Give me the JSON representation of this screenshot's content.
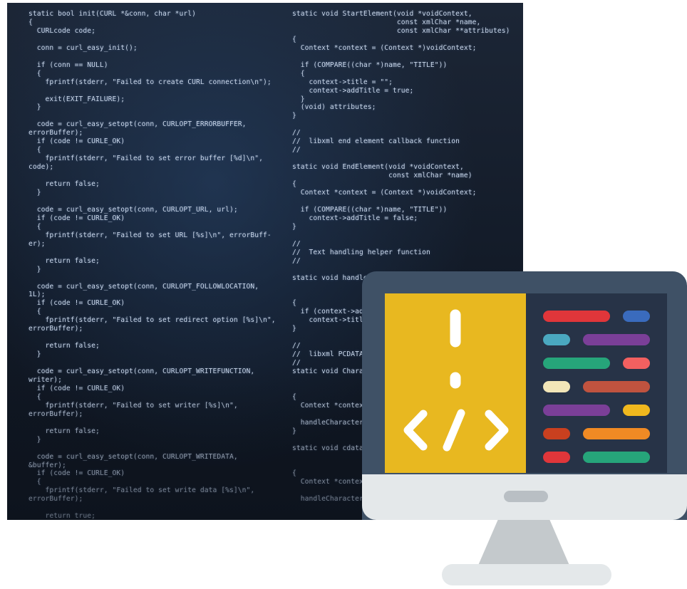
{
  "code_left": [
    "static bool init(CURL *&conn, char *url)",
    "{",
    "  CURLcode code;",
    "",
    "  conn = curl_easy_init();",
    "",
    "  if (conn == NULL)",
    "  {",
    "    fprintf(stderr, \"Failed to create CURL connection\\n\");",
    "",
    "    exit(EXIT_FAILURE);",
    "  }",
    "",
    "  code = curl_easy_setopt(conn, CURLOPT_ERRORBUFFER,",
    "errorBuffer);",
    "  if (code != CURLE_OK)",
    "  {",
    "    fprintf(stderr, \"Failed to set error buffer [%d]\\n\",",
    "code);",
    "",
    "    return false;",
    "  }",
    "",
    "  code = curl_easy_setopt(conn, CURLOPT_URL, url);",
    "  if (code != CURLE_OK)",
    "  {",
    "    fprintf(stderr, \"Failed to set URL [%s]\\n\", errorBuff-",
    "er);",
    "",
    "    return false;",
    "  }",
    "",
    "  code = curl_easy_setopt(conn, CURLOPT_FOLLOWLOCATION,",
    "1L);",
    "  if (code != CURLE_OK)",
    "  {",
    "    fprintf(stderr, \"Failed to set redirect option [%s]\\n\",",
    "errorBuffer);",
    "",
    "    return false;",
    "  }",
    "",
    "  code = curl_easy_setopt(conn, CURLOPT_WRITEFUNCTION,",
    "writer);",
    "  if (code != CURLE_OK)",
    "  {",
    "    fprintf(stderr, \"Failed to set writer [%s]\\n\",",
    "errorBuffer);",
    "",
    "    return false;",
    "  }",
    "",
    "  code = curl_easy_setopt(conn, CURLOPT_WRITEDATA,",
    "&buffer);",
    "  if (code != CURLE_OK)",
    "  {",
    "    fprintf(stderr, \"Failed to set write data [%s]\\n\",",
    "errorBuffer);",
    "",
    "    return true;"
  ],
  "code_right": [
    "static void StartElement(void *voidContext,",
    "                         const xmlChar *name,",
    "                         const xmlChar **attributes)",
    "{",
    "  Context *context = (Context *)voidContext;",
    "",
    "  if (COMPARE((char *)name, \"TITLE\"))",
    "  {",
    "    context->title = \"\";",
    "    context->addTitle = true;",
    "  }",
    "  (void) attributes;",
    "}",
    "",
    "//",
    "//  libxml end element callback function",
    "//",
    "",
    "static void EndElement(void *voidContext,",
    "                       const xmlChar *name)",
    "{",
    "  Context *context = (Context *)voidContext;",
    "",
    "  if (COMPARE((char *)name, \"TITLE\"))",
    "    context->addTitle = false;",
    "}",
    "",
    "//",
    "//  Text handling helper function",
    "//",
    "",
    "static void handleCharacters(Context *context,",
    "",
    "",
    "{",
    "  if (context->addTitle)",
    "    context->title.append(",
    "}",
    "",
    "//",
    "//  libxml PCDATA callback function",
    "//",
    "static void Characters(void *voidContext,",
    "",
    "",
    "{",
    "  Context *context = (Context *)voidContext;",
    "",
    "  handleCharacters(context, chars, length);",
    "}",
    "",
    "static void cdata(void *voidContext,",
    "",
    "",
    "{",
    "  Context *context = (Context *)voidContext;",
    "",
    "  handleCharacters(context, chars, length);"
  ],
  "monitor": {
    "accent_color": "#e8b820",
    "frame_color": "#3f5166",
    "panel_color": "#273347",
    "icons": [
      "exclamation-icon",
      "code-tag-icon"
    ]
  },
  "code_lines": [
    [
      {
        "color": "#e0363a"
      },
      {
        "color": "#3a6bbd"
      }
    ],
    [
      {
        "color": "#4aa8c0"
      },
      {
        "color": "#7b3f98"
      }
    ],
    [
      {
        "color": "#26a57a"
      },
      {
        "color": "#f26060"
      }
    ],
    [
      {
        "color": "#f2e6b8"
      },
      {
        "color": "#c0533f"
      }
    ],
    [
      {
        "color": "#7b3f98"
      },
      {
        "color": "#f0b81e"
      }
    ],
    [
      {
        "color": "#c9401f"
      },
      {
        "color": "#f08a24"
      }
    ],
    [
      {
        "color": "#e0363a"
      },
      {
        "color": "#26a57a"
      }
    ]
  ]
}
